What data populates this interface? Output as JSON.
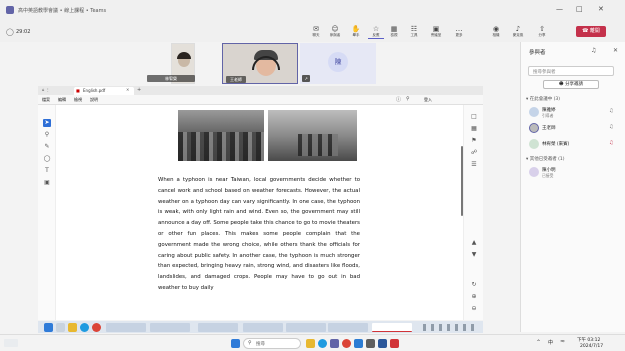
{
  "window": {
    "title": "高中英語教學會議 • 線上課程 • Teams",
    "controls": [
      "—",
      "□",
      "✕"
    ]
  },
  "meeting": {
    "timer": "29:02",
    "toolbar": [
      {
        "icon": "✉",
        "label": "聊天"
      },
      {
        "icon": "☺",
        "label": "參與者"
      },
      {
        "icon": "✋",
        "label": "舉手"
      },
      {
        "icon": "☆",
        "label": "反應"
      },
      {
        "icon": "▦",
        "label": "檢視"
      },
      {
        "icon": "☷",
        "label": "工具"
      },
      {
        "icon": "▣",
        "label": "會議室"
      },
      {
        "icon": "…",
        "label": "更多"
      },
      {
        "icon": "◉",
        "label": "相機"
      },
      {
        "icon": "♪",
        "label": "麥克風"
      },
      {
        "icon": "⇧",
        "label": "分享"
      }
    ],
    "leave_label": "離開"
  },
  "videos": [
    {
      "name": "林宥榮"
    },
    {
      "name": "王老師"
    },
    {
      "initials": "陳"
    }
  ],
  "right_panel": {
    "title": "參與者",
    "search_placeholder": "搜尋參與者",
    "invite_label": "分享邀請",
    "section1": "▾ 在此會議中 (3)",
    "section2": "▾ 其他已受邀者 (1)",
    "people": [
      {
        "name": "陳雅婷",
        "role": "引導者"
      },
      {
        "name": "王老師",
        "role": ""
      },
      {
        "name": "林宥榮 (來賓)",
        "role": ""
      }
    ],
    "invited": [
      {
        "name": "陳小明",
        "role": "已接受"
      }
    ]
  },
  "viewer": {
    "tab_label": "English.pdf",
    "menu": [
      "檔案",
      "編輯",
      "檢視",
      "說明"
    ],
    "login_label": "登入"
  },
  "document": {
    "paragraph": "When a typhoon is near Taiwan, local governments decide whether to cancel work and school based on weather forecasts. However, the actual weather on a typhoon day can vary significantly. In one case, the typhoon is weak, with only light rain and wind. Even so, the government may still announce a day off. Some people take this chance to go to movie theaters or other fun places. This makes some people complain that the government made the wrong choice, while others thank the officials for caring about public safety. In another case, the typhoon is much stronger than expected, bringing heavy rain, strong wind, and disasters like floods, landslides, and damaged crops. People may have to go out in bad weather to buy daily"
  },
  "taskbar": {
    "search_placeholder": "搜尋",
    "time": "下午 03:12",
    "date": "2024/7/17",
    "lang": "中"
  }
}
